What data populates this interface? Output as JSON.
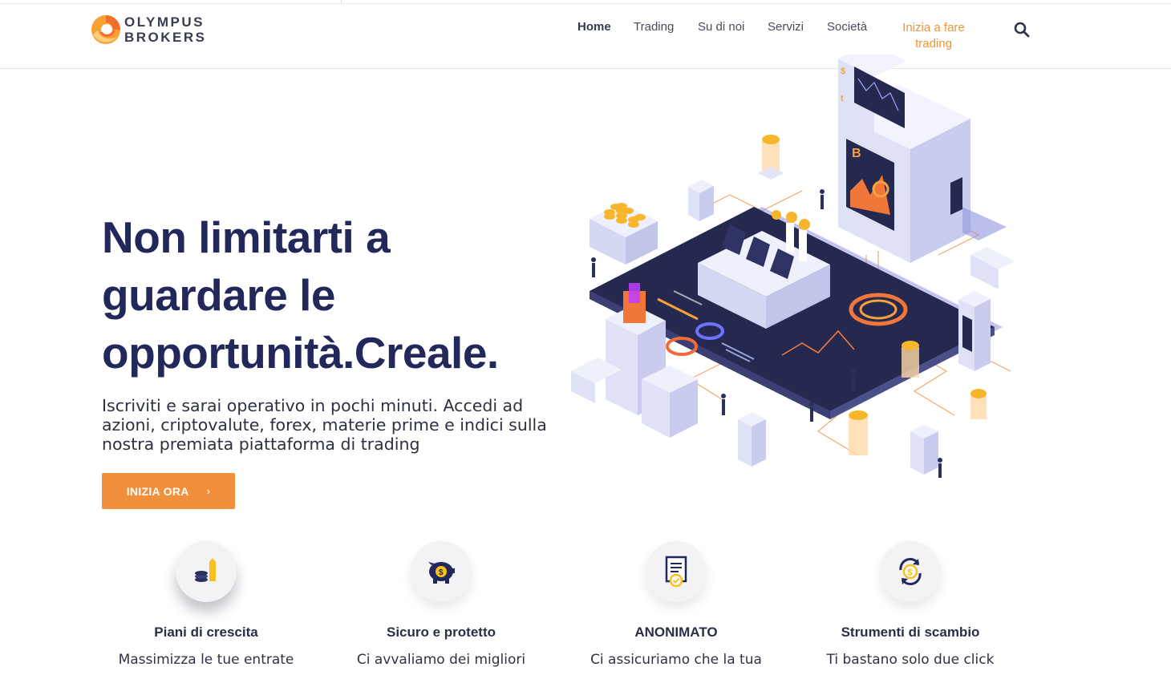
{
  "brand": {
    "line1": "OLYMPUS",
    "line2": "BROKERS",
    "accent": "#f18f3b",
    "navy": "#23285a"
  },
  "nav": {
    "items": [
      "Home",
      "Trading",
      "Su di noi",
      "Servizi",
      "Società"
    ],
    "cta_line1": "Inizia a fare",
    "cta_line2": "trading",
    "search_icon": "search-icon"
  },
  "hero": {
    "title_line1": "Non limitarti a",
    "title_line2": "guardare le",
    "title_line3": "opportunità.Creale.",
    "subtitle_line1": "Iscriviti e sarai operativo in pochi minuti. Accedi ad",
    "subtitle_line2": "azioni, criptovalute, forex, materie prime e indici sulla",
    "subtitle_line3": "nostra premiata piattaforma di trading",
    "button_label": "INIZIA ORA",
    "button_icon": "chevron-right-icon",
    "illustration_marks": [
      "$",
      "B",
      "t"
    ]
  },
  "features": [
    {
      "icon": "coins-growth-icon",
      "title": "Piani di crescita",
      "text": "Massimizza le tue entrate"
    },
    {
      "icon": "piggy-bank-icon",
      "title": "Sicuro e protetto",
      "text": "Ci avvaliamo dei migliori"
    },
    {
      "icon": "document-check-icon",
      "title": "ANONIMATO",
      "text": "Ci assicuriamo che la tua"
    },
    {
      "icon": "exchange-icon",
      "title": "Strumenti di scambio",
      "text": "Ti bastano solo due click"
    }
  ]
}
